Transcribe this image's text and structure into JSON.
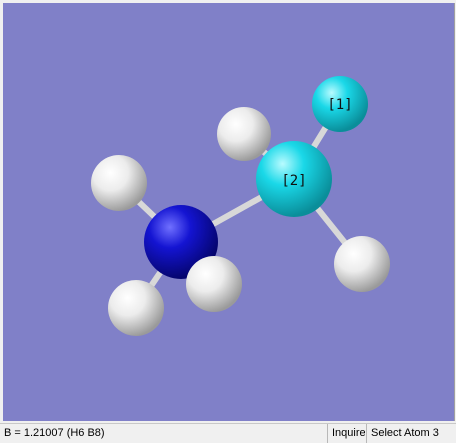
{
  "viewer": {
    "background_color": "#8080c8",
    "atoms": [
      {
        "id": "F1",
        "element": "F",
        "color": "#16d2e0",
        "label": "[1]"
      },
      {
        "id": "C2",
        "element": "C",
        "color": "#1ad4e4",
        "label": "[2]"
      },
      {
        "id": "N3",
        "element": "N",
        "color": "#1414c8",
        "label": ""
      },
      {
        "id": "H4",
        "element": "H",
        "color": "#e8e8e8",
        "label": ""
      },
      {
        "id": "H5",
        "element": "H",
        "color": "#e8e8e8",
        "label": ""
      },
      {
        "id": "H6",
        "element": "H",
        "color": "#e8e8e8",
        "label": ""
      },
      {
        "id": "H7",
        "element": "H",
        "color": "#e8e8e8",
        "label": ""
      },
      {
        "id": "H8",
        "element": "H",
        "color": "#e8e8e8",
        "label": ""
      }
    ]
  },
  "status_bar": {
    "measurement": "B = 1.21007 (H6 B8)",
    "mode": "Inquire",
    "prompt": "Select Atom 3"
  }
}
